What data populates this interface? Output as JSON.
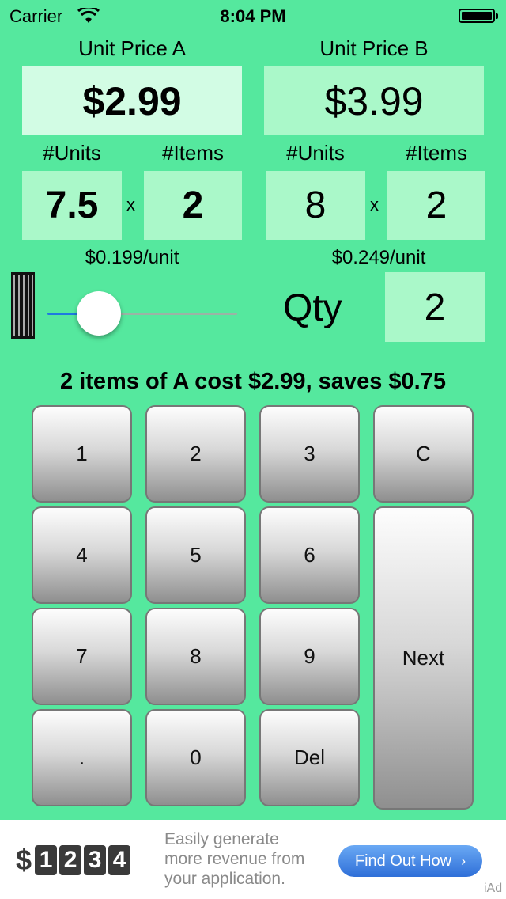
{
  "status_bar": {
    "carrier": "Carrier",
    "time": "8:04 PM"
  },
  "price_a": {
    "label": "Unit Price A",
    "value": "$2.99",
    "units_label": "#Units",
    "items_label": "#Items",
    "units": "7.5",
    "items": "2",
    "per_unit": "$0.199/unit"
  },
  "price_b": {
    "label": "Unit Price B",
    "value": "$3.99",
    "units_label": "#Units",
    "items_label": "#Items",
    "units": "8",
    "items": "2",
    "per_unit": "$0.249/unit"
  },
  "times_symbol": "x",
  "quantity": {
    "label": "Qty",
    "value": "2",
    "slider_fraction": 0.2
  },
  "result": "2 items of A cost $2.99, saves $0.75",
  "keypad": {
    "k1": "1",
    "k2": "2",
    "k3": "3",
    "clear": "C",
    "k4": "4",
    "k5": "5",
    "k6": "6",
    "next": "Next",
    "k7": "7",
    "k8": "8",
    "k9": "9",
    "dot": ".",
    "k0": "0",
    "del": "Del"
  },
  "ad": {
    "dollar": "$",
    "digits": [
      "1",
      "2",
      "3",
      "4"
    ],
    "line1": "Easily generate",
    "line2": "more revenue from",
    "line3": "your application.",
    "button": "Find Out How",
    "brand": "iAd"
  },
  "colors": {
    "background": "#55e89e",
    "field": "#aaf8c9",
    "field_selected": "#d2fce4",
    "slider": "#1f7ae0"
  }
}
